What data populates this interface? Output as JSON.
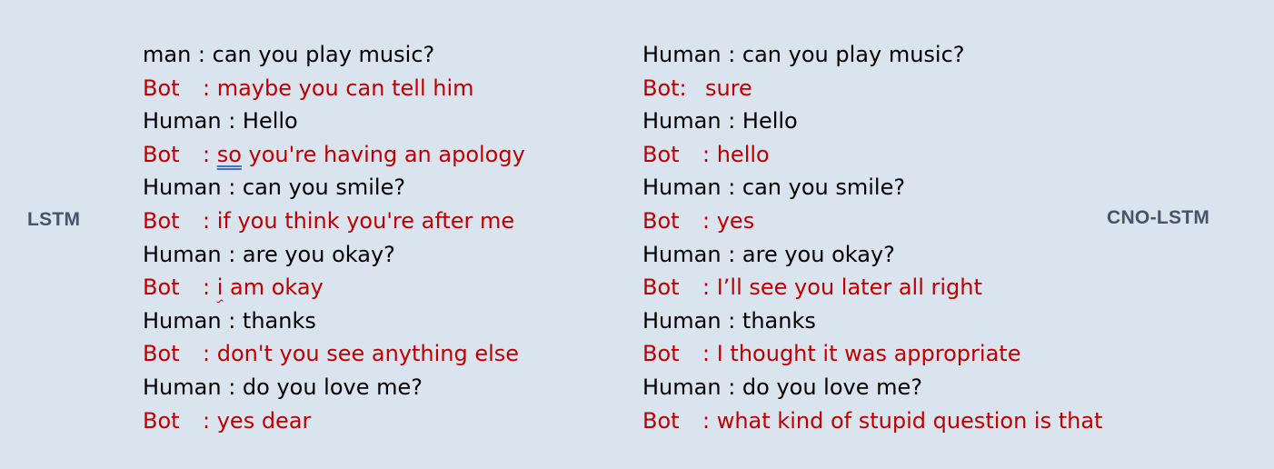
{
  "left": {
    "label": "LSTM",
    "lines": [
      {
        "speaker": "man",
        "sep": " : ",
        "text": "can you play music?",
        "kind": "human"
      },
      {
        "speaker": "Bot",
        "sep": ": ",
        "text": "maybe you can tell him",
        "kind": "bot"
      },
      {
        "speaker": "Human",
        "sep": " : ",
        "text": "Hello",
        "kind": "human"
      },
      {
        "speaker": "Bot",
        "sep": ": ",
        "pre": "so",
        "text": " you're having an apology",
        "kind": "bot"
      },
      {
        "speaker": "Human",
        "sep": " : ",
        "text": "can you smile?",
        "kind": "human"
      },
      {
        "speaker": "Bot",
        "sep": ": ",
        "text": "if you think you're after me",
        "kind": "bot"
      },
      {
        "speaker": "Human",
        "sep": " : ",
        "text": "are you okay?",
        "kind": "human"
      },
      {
        "speaker": "Bot",
        "sep": ": ",
        "pre": "i",
        "text": " am okay",
        "kind": "bot"
      },
      {
        "speaker": "Human",
        "sep": " : ",
        "text": "thanks",
        "kind": "human"
      },
      {
        "speaker": "Bot",
        "sep": ": ",
        "text": "don't you see anything else",
        "kind": "bot"
      },
      {
        "speaker": "Human",
        "sep": " : ",
        "text": "do you love me?",
        "kind": "human"
      },
      {
        "speaker": "Bot",
        "sep": ": ",
        "text": "yes dear",
        "kind": "bot"
      }
    ]
  },
  "right": {
    "label": "CNO-LSTM",
    "lines": [
      {
        "speaker": "Human",
        "sep": " : ",
        "text": "can you play music?",
        "kind": "human"
      },
      {
        "speaker": "Bot:",
        "sep": "",
        "text": "sure",
        "kind": "bot"
      },
      {
        "speaker": "Human",
        "sep": " : ",
        "text": "Hello",
        "kind": "human"
      },
      {
        "speaker": "Bot",
        "sep": ": ",
        "text": "hello",
        "kind": "bot"
      },
      {
        "speaker": "Human",
        "sep": " : ",
        "text": "can you smile?",
        "kind": "human"
      },
      {
        "speaker": "Bot",
        "sep": ": ",
        "text": "yes",
        "kind": "bot"
      },
      {
        "speaker": "Human",
        "sep": " : ",
        "text": "are you okay?",
        "kind": "human"
      },
      {
        "speaker": "Bot",
        "sep": ": ",
        "text": "I’ll see you later all right",
        "kind": "bot"
      },
      {
        "speaker": "Human",
        "sep": " : ",
        "text": "thanks",
        "kind": "human"
      },
      {
        "speaker": "Bot",
        "sep": ": ",
        "text": "I thought it was appropriate",
        "kind": "bot"
      },
      {
        "speaker": "Human",
        "sep": " : ",
        "text": "do you love me?",
        "kind": "human"
      },
      {
        "speaker": "Bot",
        "sep": ": ",
        "text": "what kind of stupid question is that",
        "kind": "bot"
      }
    ]
  }
}
